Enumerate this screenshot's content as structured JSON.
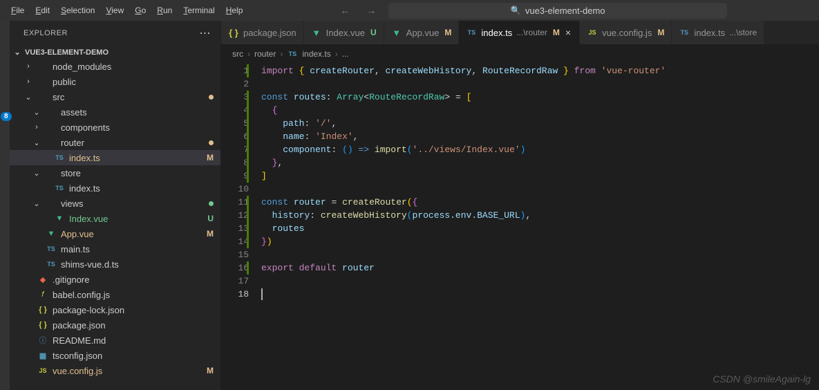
{
  "menubar": {
    "items": [
      "File",
      "Edit",
      "Selection",
      "View",
      "Go",
      "Run",
      "Terminal",
      "Help"
    ]
  },
  "search": {
    "placeholder": "vue3-element-demo"
  },
  "badge": {
    "count": "8"
  },
  "sidebar": {
    "title": "EXPLORER",
    "project": "VUE3-ELEMENT-DEMO",
    "tree": [
      {
        "indent": 1,
        "chev": "›",
        "icon": "folder",
        "label": "node_modules"
      },
      {
        "indent": 1,
        "chev": "›",
        "icon": "folder",
        "label": "public"
      },
      {
        "indent": 1,
        "chev": "⌄",
        "icon": "folder",
        "label": "src",
        "badge": "dot-m"
      },
      {
        "indent": 2,
        "chev": "⌄",
        "icon": "folder",
        "label": "assets"
      },
      {
        "indent": 2,
        "chev": "›",
        "icon": "folder",
        "label": "components"
      },
      {
        "indent": 2,
        "chev": "⌄",
        "icon": "folder",
        "label": "router",
        "badge": "dot-m"
      },
      {
        "indent": 3,
        "icon": "ts",
        "label": "index.ts",
        "selected": true,
        "status": "M",
        "mod": true
      },
      {
        "indent": 2,
        "chev": "⌄",
        "icon": "folder",
        "label": "store"
      },
      {
        "indent": 3,
        "icon": "ts",
        "label": "index.ts"
      },
      {
        "indent": 2,
        "chev": "⌄",
        "icon": "folder",
        "label": "views",
        "badge": "dot-u"
      },
      {
        "indent": 3,
        "icon": "vue",
        "label": "Index.vue",
        "status": "U",
        "untracked": true
      },
      {
        "indent": 2,
        "icon": "vue",
        "label": "App.vue",
        "status": "M",
        "mod": true
      },
      {
        "indent": 2,
        "icon": "ts",
        "label": "main.ts"
      },
      {
        "indent": 2,
        "icon": "ts",
        "label": "shims-vue.d.ts"
      },
      {
        "indent": 1,
        "icon": "git",
        "label": ".gitignore"
      },
      {
        "indent": 1,
        "icon": "babel",
        "label": "babel.config.js"
      },
      {
        "indent": 1,
        "icon": "json",
        "label": "package-lock.json"
      },
      {
        "indent": 1,
        "icon": "json",
        "label": "package.json"
      },
      {
        "indent": 1,
        "icon": "md",
        "label": "README.md"
      },
      {
        "indent": 1,
        "icon": "json2",
        "label": "tsconfig.json"
      },
      {
        "indent": 1,
        "icon": "js",
        "label": "vue.config.js",
        "status": "M",
        "mod": true
      }
    ]
  },
  "tabs": [
    {
      "icon": "json",
      "label": "package.json"
    },
    {
      "icon": "vue",
      "label": "Index.vue",
      "status": "U",
      "statusClass": "badge-u"
    },
    {
      "icon": "vue",
      "label": "App.vue",
      "status": "M",
      "statusClass": "badge-m"
    },
    {
      "icon": "ts",
      "label": "index.ts",
      "detail": "...\\router",
      "status": "M",
      "statusClass": "badge-m",
      "active": true,
      "close": true
    },
    {
      "icon": "js",
      "label": "vue.config.js",
      "status": "M",
      "statusClass": "badge-m"
    },
    {
      "icon": "ts",
      "label": "index.ts",
      "detail": "...\\store"
    }
  ],
  "breadcrumb": {
    "parts": [
      "src",
      "router",
      "index.ts",
      "..."
    ],
    "icon": "ts"
  },
  "code": {
    "lines": 18,
    "current": 18
  },
  "watermark": "CSDN @smileAgain-lg"
}
